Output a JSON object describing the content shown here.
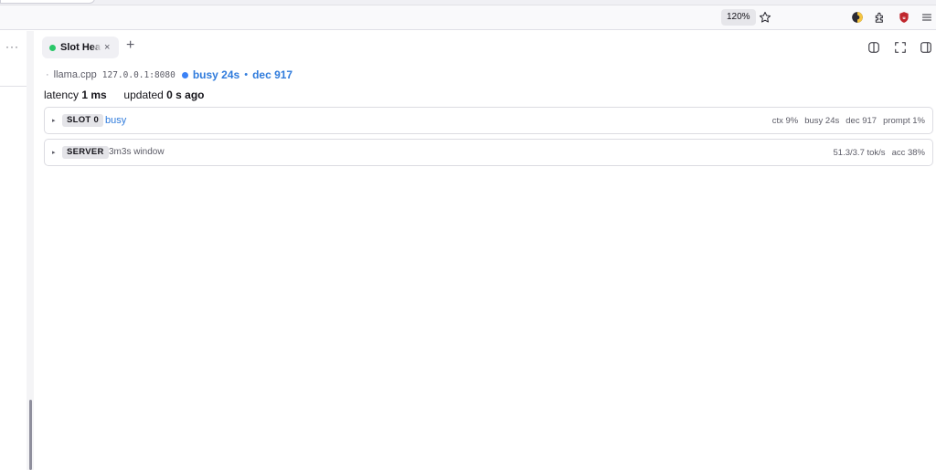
{
  "browser": {
    "zoom": "120%"
  },
  "tab": {
    "title": "Slot Health",
    "close_glyph": "×",
    "new_glyph": "+"
  },
  "sidebar": {
    "more_glyph": "···"
  },
  "status": {
    "separator": "·",
    "server_name": "llama.cpp",
    "address": "127.0.0.1:8080",
    "busy": "busy 24s",
    "middle_dot": "•",
    "dec": "dec 917"
  },
  "latency": {
    "label": "latency",
    "value": "1 ms",
    "updated_label": "updated",
    "updated_value": "0 s ago"
  },
  "slot": {
    "caret": "▸",
    "tag": "SLOT 0",
    "state": "busy",
    "stats": [
      "ctx 9%",
      "busy 24s",
      "dec 917",
      "prompt 1%"
    ]
  },
  "server": {
    "caret": "▸",
    "tag": "SERVER",
    "window": "3m3s window",
    "stats": [
      "51.3/3.7 tok/s",
      "acc 38%"
    ]
  },
  "colors": {
    "accent_blue": "#2f7bdc",
    "status_green": "#2ac769",
    "ublock_red": "#c0262d"
  }
}
